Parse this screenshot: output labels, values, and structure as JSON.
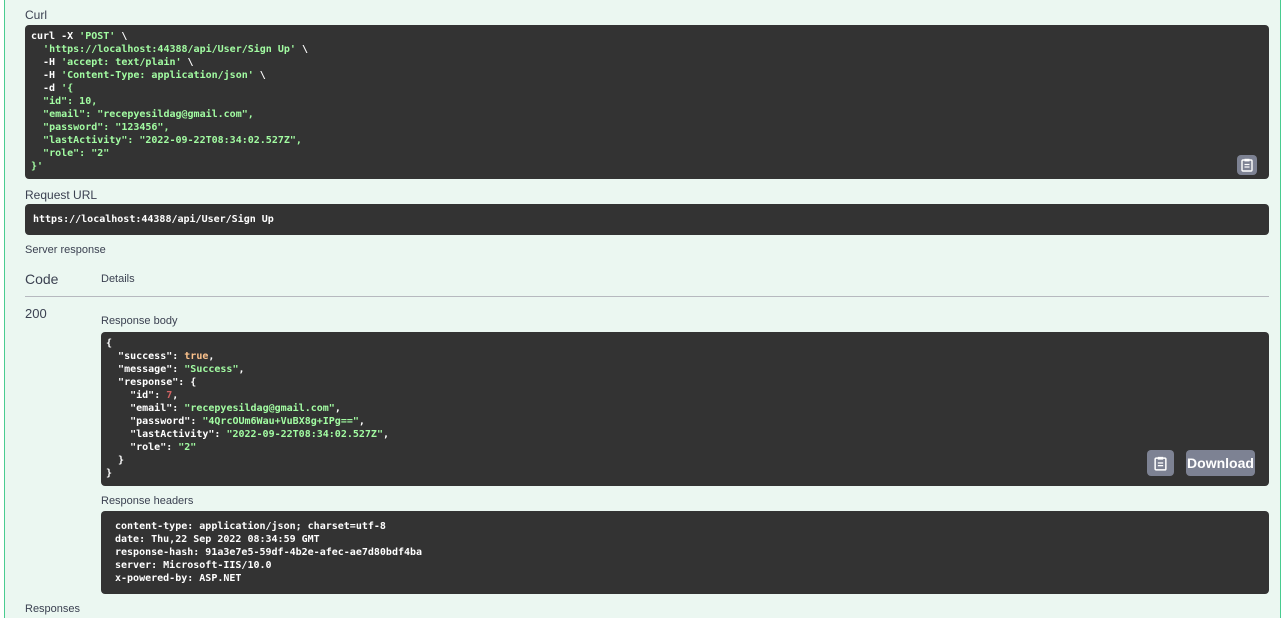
{
  "curl_section": {
    "label": "Curl",
    "line1": "curl -X ",
    "method": "'POST'",
    "url_line": "'https://localhost:44388/api/User/Sign Up'",
    "h1": "'accept: text/plain'",
    "h2": "'Content-Type: application/json'",
    "d_open": "'{",
    "id_key": "\"id\": 10,",
    "email_key": "\"email\": \"recepyesildag@gmail.com\",",
    "password_key": "\"password\": \"123456\",",
    "lastActivity_key": "\"lastActivity\": \"2022-09-22T08:34:02.527Z\",",
    "role_key": "\"role\": \"2\"",
    "d_close": "}'"
  },
  "request_url": {
    "label": "Request URL",
    "value": "https://localhost:44388/api/User/Sign Up"
  },
  "server_response": {
    "label": "Server response",
    "code_header": "Code",
    "details_header": "Details",
    "code": "200",
    "body_label": "Response body",
    "headers_label": "Response headers",
    "download_label": "Download",
    "body": {
      "success_key": "\"success\"",
      "success_val": "true",
      "message_key": "\"message\"",
      "message_val": "\"Success\"",
      "response_key": "\"response\"",
      "id_key": "\"id\"",
      "id_val": "7",
      "email_key": "\"email\"",
      "email_val": "\"recepyesildag@gmail.com\"",
      "password_key": "\"password\"",
      "password_val": "\"4QrcOUm6Wau+VuBX8g+IPg==\"",
      "lastActivity_key": "\"lastActivity\"",
      "lastActivity_val": "\"2022-09-22T08:34:02.527Z\"",
      "role_key": "\"role\"",
      "role_val": "\"2\""
    },
    "headers": [
      "content-type: application/json; charset=utf-8",
      "date: Thu,22 Sep 2022 08:34:59 GMT",
      "response-hash: 91a3e7e5-59df-4b2e-afec-ae7d80bdf4ba",
      "server: Microsoft-IIS/10.0",
      "x-powered-by: ASP.NET"
    ]
  },
  "responses_label": "Responses",
  "icons": [
    "clipboard-icon"
  ]
}
